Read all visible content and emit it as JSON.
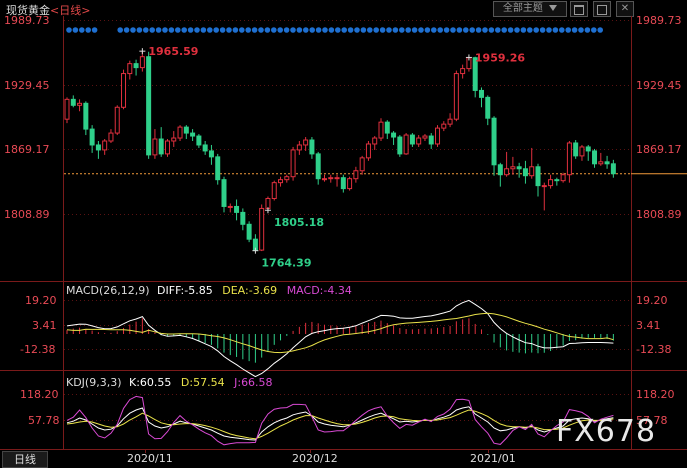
{
  "header": {
    "instrument": "现货黄金",
    "period": "<日线>",
    "sector_button": "全部主题",
    "dropdown_icon": "triangle-down-icon",
    "ctrl_icons": [
      "chart-toggle-icon",
      "square-icon",
      "close-icon"
    ]
  },
  "colors": {
    "up": "#e0303e",
    "down": "#2fd08a",
    "price_line": "#f29a3a",
    "dif": "#ffffff",
    "dea": "#e9e24a",
    "macd": "#d94ad4",
    "k": "#ffffff",
    "d": "#e9e24a",
    "j": "#d94ad4",
    "axis_label": "#e84a55",
    "grid": "#7a1a1a",
    "event_dots": "#1e6fd0"
  },
  "price_axis": {
    "labels": [
      "1989.73",
      "1929.45",
      "1869.17",
      "1808.89"
    ]
  },
  "macd_panel": {
    "title": "MACD(26,12,9)",
    "dif_label": "DIFF:",
    "dif_value": "-5.85",
    "dea_label": "DEA:",
    "dea_value": "-3.69",
    "macd_label": "MACD:",
    "macd_value": "-4.34",
    "axis_labels": [
      "19.20",
      "3.41",
      "-12.38"
    ]
  },
  "kdj_panel": {
    "title": "KDJ(9,3,3)",
    "k_label": "K:",
    "k_value": "60.55",
    "d_label": "D:",
    "d_value": "57.54",
    "j_label": "J:",
    "j_value": "66.58",
    "axis_labels": [
      "118.20",
      "57.78"
    ]
  },
  "footer": {
    "period_button": "日线",
    "date_ticks": [
      "2020/11",
      "2020/12",
      "2021/01"
    ],
    "watermark": "FX678"
  },
  "chart_data": {
    "type": "candlestick",
    "title": "现货黄金 <日线>",
    "ylim": [
      1755,
      1995
    ],
    "annotations": [
      {
        "label": "1965.59",
        "value": 1965.59
      },
      {
        "label": "1959.26",
        "value": 1959.26
      },
      {
        "label": "1764.39",
        "value": 1764.39
      },
      {
        "label": "1805.18",
        "value": 1805.18
      }
    ],
    "candles": [
      [
        1897,
        1917,
        1893,
        1919
      ],
      [
        1917,
        1911,
        1909,
        1921
      ],
      [
        1911,
        1913,
        1905,
        1917
      ],
      [
        1913,
        1887,
        1881,
        1915
      ],
      [
        1887,
        1871,
        1863,
        1891
      ],
      [
        1871,
        1866,
        1857,
        1875
      ],
      [
        1866,
        1875,
        1861,
        1877
      ],
      [
        1875,
        1883,
        1873,
        1887
      ],
      [
        1883,
        1909,
        1881,
        1911
      ],
      [
        1909,
        1943,
        1907,
        1947
      ],
      [
        1943,
        1953,
        1937,
        1956
      ],
      [
        1953,
        1949,
        1941,
        1957
      ],
      [
        1949,
        1960,
        1945,
        1966
      ],
      [
        1960,
        1861,
        1857,
        1965
      ],
      [
        1861,
        1877,
        1857,
        1887
      ],
      [
        1877,
        1862,
        1859,
        1889
      ],
      [
        1862,
        1875,
        1859,
        1877
      ],
      [
        1875,
        1878,
        1869,
        1885
      ],
      [
        1878,
        1889,
        1875,
        1891
      ],
      [
        1889,
        1883,
        1877,
        1891
      ],
      [
        1883,
        1880,
        1875,
        1887
      ],
      [
        1880,
        1871,
        1868,
        1882
      ],
      [
        1871,
        1865,
        1861,
        1875
      ],
      [
        1865,
        1859,
        1851,
        1871
      ],
      [
        1859,
        1836,
        1831,
        1862
      ],
      [
        1836,
        1809,
        1803,
        1839
      ],
      [
        1809,
        1809,
        1803,
        1812
      ],
      [
        1809,
        1803,
        1795,
        1816
      ],
      [
        1803,
        1791,
        1785,
        1807
      ],
      [
        1791,
        1776,
        1773,
        1794
      ],
      [
        1776,
        1765,
        1764,
        1781
      ],
      [
        1765,
        1807,
        1764,
        1811
      ],
      [
        1807,
        1817,
        1805,
        1819
      ],
      [
        1817,
        1833,
        1815,
        1835
      ],
      [
        1833,
        1836,
        1829,
        1839
      ],
      [
        1836,
        1839,
        1833,
        1841
      ],
      [
        1839,
        1866,
        1835,
        1869
      ],
      [
        1866,
        1871,
        1861,
        1875
      ],
      [
        1871,
        1876,
        1865,
        1879
      ],
      [
        1876,
        1862,
        1857,
        1879
      ],
      [
        1862,
        1837,
        1831,
        1864
      ],
      [
        1837,
        1837,
        1834,
        1841
      ],
      [
        1837,
        1838,
        1833,
        1841
      ],
      [
        1838,
        1838,
        1829,
        1841
      ],
      [
        1838,
        1827,
        1823,
        1841
      ],
      [
        1827,
        1837,
        1825,
        1839
      ],
      [
        1837,
        1845,
        1833,
        1849
      ],
      [
        1845,
        1858,
        1841,
        1860
      ],
      [
        1858,
        1872,
        1855,
        1875
      ],
      [
        1872,
        1878,
        1866,
        1880
      ],
      [
        1878,
        1894,
        1875,
        1898
      ],
      [
        1894,
        1883,
        1877,
        1896
      ],
      [
        1883,
        1879,
        1871,
        1885
      ],
      [
        1879,
        1862,
        1859,
        1881
      ],
      [
        1862,
        1881,
        1861,
        1883
      ],
      [
        1881,
        1872,
        1869,
        1883
      ],
      [
        1872,
        1878,
        1869,
        1881
      ],
      [
        1878,
        1880,
        1875,
        1882
      ],
      [
        1880,
        1872,
        1867,
        1883
      ],
      [
        1872,
        1888,
        1869,
        1891
      ],
      [
        1888,
        1892,
        1885,
        1895
      ],
      [
        1892,
        1897,
        1889,
        1903
      ],
      [
        1897,
        1943,
        1895,
        1946
      ],
      [
        1943,
        1948,
        1938,
        1952
      ],
      [
        1948,
        1959,
        1945,
        1959
      ],
      [
        1959,
        1926,
        1919,
        1960
      ],
      [
        1926,
        1919,
        1909,
        1929
      ],
      [
        1919,
        1898,
        1891,
        1921
      ],
      [
        1898,
        1851,
        1840,
        1900
      ],
      [
        1851,
        1841,
        1829,
        1853
      ],
      [
        1841,
        1847,
        1839,
        1864
      ],
      [
        1847,
        1849,
        1841,
        1859
      ],
      [
        1849,
        1847,
        1838,
        1853
      ],
      [
        1847,
        1840,
        1832,
        1855
      ],
      [
        1840,
        1849,
        1837,
        1868
      ],
      [
        1849,
        1830,
        1819,
        1852
      ],
      [
        1830,
        1830,
        1805,
        1833
      ],
      [
        1830,
        1836,
        1827,
        1841
      ],
      [
        1836,
        1835,
        1830,
        1838
      ],
      [
        1835,
        1841,
        1833,
        1843
      ],
      [
        1841,
        1873,
        1833,
        1875
      ],
      [
        1873,
        1860,
        1857,
        1876
      ],
      [
        1860,
        1869,
        1855,
        1871
      ],
      [
        1869,
        1865,
        1855,
        1871
      ],
      [
        1865,
        1852,
        1848,
        1867
      ],
      [
        1852,
        1854,
        1850,
        1863
      ],
      [
        1854,
        1852,
        1847,
        1860
      ],
      [
        1852,
        1842,
        1838,
        1856
      ]
    ],
    "macd_histogram": [
      2.5,
      3.5,
      4.1,
      3.2,
      2.2,
      1.1,
      0.5,
      0.7,
      1.8,
      3.9,
      6.1,
      8.0,
      10.2,
      3.2,
      1.0,
      -0.8,
      -1.5,
      -1.2,
      -1.1,
      -2.0,
      -3.0,
      -4.5,
      -5.8,
      -7.0,
      -9.3,
      -12.0,
      -13.6,
      -14.8,
      -16.3,
      -17.5,
      -18.5,
      -15.2,
      -11.1,
      -7.0,
      -4.1,
      -1.2,
      2.0,
      4.6,
      7.2,
      7.8,
      6.9,
      6.0,
      5.6,
      5.0,
      4.2,
      4.5,
      5.0,
      6.1,
      7.1,
      7.8,
      8.6,
      7.0,
      5.5,
      3.8,
      3.2,
      3.0,
      3.2,
      3.5,
      3.6,
      4.0,
      4.5,
      5.2,
      8.2,
      9.4,
      10.1,
      6.5,
      3.0,
      -0.5,
      -5.5,
      -8.6,
      -10.6,
      -11.5,
      -12.0,
      -12.5,
      -12.0,
      -12.4,
      -12.1,
      -11.0,
      -9.2,
      -7.5,
      -4.5,
      -4.0,
      -3.0,
      -2.5,
      -2.5,
      -2.5,
      -3.2,
      -4.3
    ],
    "dif": [
      5.2,
      5.8,
      6.4,
      6.3,
      5.2,
      4.1,
      3.4,
      3.5,
      4.6,
      6.6,
      8.5,
      9.7,
      11.2,
      5.6,
      2.4,
      -0.4,
      -1.5,
      -1.2,
      -0.9,
      -1.8,
      -2.9,
      -4.5,
      -6.3,
      -8.1,
      -10.9,
      -14.5,
      -17.3,
      -19.8,
      -22.6,
      -25.0,
      -27.5,
      -25.5,
      -22.4,
      -18.9,
      -16.0,
      -12.8,
      -8.9,
      -5.3,
      -1.8,
      0.4,
      1.5,
      2.2,
      3.0,
      3.5,
      3.7,
      4.4,
      5.3,
      7.0,
      8.6,
      10.2,
      12.0,
      11.9,
      11.5,
      10.4,
      10.2,
      10.2,
      10.7,
      11.3,
      11.7,
      12.6,
      13.6,
      14.8,
      18.1,
      20.2,
      21.7,
      19.1,
      16.4,
      13.1,
      7.5,
      3.5,
      0.4,
      -1.9,
      -3.9,
      -5.6,
      -6.2,
      -7.9,
      -9.0,
      -9.0,
      -8.5,
      -8.2,
      -6.1,
      -6.0,
      -5.6,
      -5.5,
      -5.5,
      -5.5,
      -5.7,
      -5.85
    ],
    "dea": [
      2.7,
      2.3,
      2.3,
      3.1,
      3.0,
      3.0,
      2.9,
      2.8,
      2.8,
      2.7,
      2.4,
      1.7,
      1.0,
      2.4,
      1.4,
      0.4,
      0.0,
      0.0,
      0.2,
      0.2,
      0.1,
      0.0,
      -0.5,
      -1.1,
      -1.6,
      -2.5,
      -3.7,
      -5.0,
      -6.3,
      -7.5,
      -9.0,
      -10.3,
      -11.3,
      -11.9,
      -12.0,
      -11.6,
      -10.9,
      -9.9,
      -8.9,
      -7.4,
      -5.4,
      -3.8,
      -2.6,
      -1.5,
      -0.5,
      -0.1,
      0.3,
      0.9,
      1.5,
      2.3,
      3.4,
      4.9,
      6.0,
      6.5,
      7.0,
      7.2,
      7.5,
      7.8,
      8.1,
      8.6,
      9.1,
      9.6,
      10.0,
      10.8,
      11.6,
      12.6,
      13.1,
      13.4,
      13.0,
      12.1,
      11.0,
      9.6,
      8.1,
      6.9,
      5.8,
      4.5,
      3.1,
      2.0,
      0.8,
      -0.5,
      -1.6,
      -2.0,
      -2.6,
      -3.0,
      -3.0,
      -3.0,
      -2.5,
      -3.69
    ],
    "k": [
      48,
      52,
      60,
      55,
      45,
      35,
      30,
      32,
      40,
      58,
      72,
      80,
      85,
      50,
      40,
      35,
      38,
      45,
      52,
      48,
      45,
      40,
      35,
      30,
      22,
      15,
      12,
      10,
      8,
      6,
      5,
      25,
      38,
      48,
      55,
      60,
      68,
      72,
      75,
      65,
      50,
      45,
      42,
      40,
      38,
      42,
      48,
      55,
      62,
      68,
      72,
      65,
      58,
      50,
      52,
      50,
      52,
      55,
      53,
      58,
      62,
      68,
      80,
      85,
      88,
      70,
      60,
      50,
      35,
      28,
      30,
      35,
      38,
      35,
      40,
      30,
      25,
      30,
      35,
      40,
      55,
      58,
      60,
      58,
      52,
      55,
      58,
      60.55
    ],
    "d": [
      45,
      47,
      50,
      52,
      50,
      45,
      40,
      37,
      38,
      45,
      55,
      63,
      72,
      65,
      56,
      48,
      44,
      43,
      45,
      46,
      46,
      44,
      41,
      37,
      32,
      26,
      20,
      16,
      13,
      10,
      8,
      14,
      22,
      31,
      40,
      47,
      55,
      61,
      66,
      66,
      60,
      55,
      50,
      46,
      43,
      43,
      45,
      49,
      54,
      60,
      64,
      65,
      63,
      58,
      56,
      54,
      53,
      54,
      54,
      55,
      58,
      61,
      67,
      74,
      80,
      77,
      71,
      64,
      54,
      45,
      40,
      38,
      38,
      37,
      38,
      35,
      31,
      31,
      32,
      35,
      42,
      48,
      53,
      55,
      54,
      54,
      56,
      57.54
    ],
    "j": [
      54,
      62,
      80,
      61,
      35,
      15,
      10,
      22,
      44,
      84,
      106,
      114,
      111,
      20,
      8,
      9,
      26,
      49,
      66,
      52,
      43,
      32,
      23,
      16,
      2,
      -7,
      -4,
      -2,
      -2,
      -2,
      -1,
      47,
      70,
      82,
      85,
      86,
      94,
      94,
      93,
      63,
      30,
      25,
      26,
      28,
      28,
      40,
      54,
      67,
      78,
      84,
      88,
      65,
      48,
      34,
      44,
      42,
      50,
      57,
      51,
      64,
      70,
      82,
      106,
      107,
      104,
      56,
      38,
      22,
      -3,
      -6,
      10,
      29,
      38,
      31,
      44,
      20,
      13,
      28,
      41,
      50,
      81,
      78,
      74,
      64,
      48,
      57,
      62,
      66.58
    ]
  }
}
